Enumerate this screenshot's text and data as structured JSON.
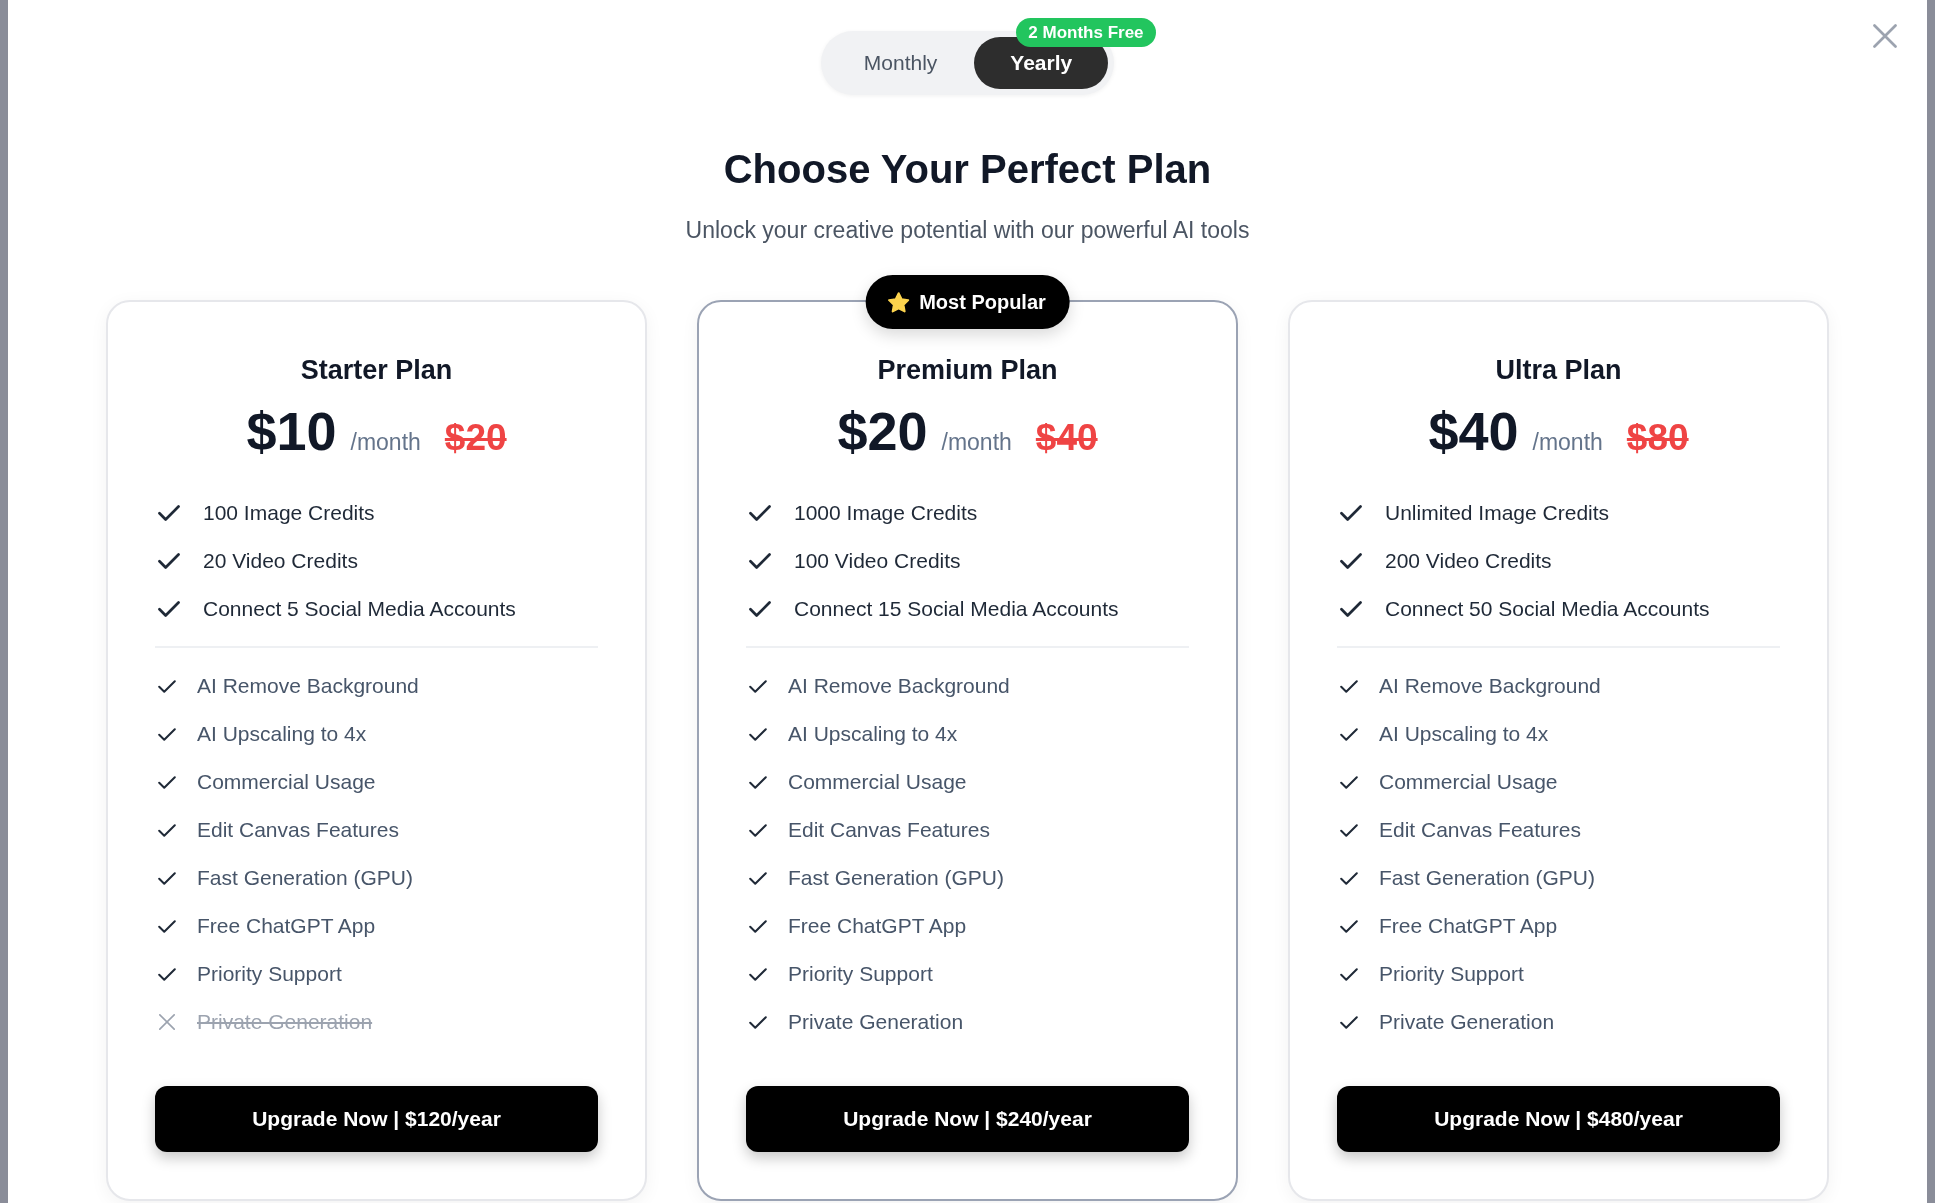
{
  "billing_toggle": {
    "options": [
      {
        "label": "Monthly",
        "selected": false
      },
      {
        "label": "Yearly",
        "selected": true,
        "badge": "2 Months Free"
      }
    ]
  },
  "title": "Choose Your Perfect Plan",
  "subtitle": "Unlock your creative potential with our powerful AI tools",
  "plans": [
    {
      "name": "Starter Plan",
      "featured": false,
      "price": "$10",
      "period": "/month",
      "original_price": "$20",
      "highlights": [
        "100 Image Credits",
        "20 Video Credits",
        "Connect 5 Social Media Accounts"
      ],
      "features": [
        {
          "label": "AI Remove Background",
          "included": true
        },
        {
          "label": "AI Upscaling to 4x",
          "included": true
        },
        {
          "label": "Commercial Usage",
          "included": true
        },
        {
          "label": "Edit Canvas Features",
          "included": true
        },
        {
          "label": "Fast Generation (GPU)",
          "included": true
        },
        {
          "label": "Free ChatGPT App",
          "included": true
        },
        {
          "label": "Priority Support",
          "included": true
        },
        {
          "label": "Private Generation",
          "included": false
        }
      ],
      "button": "Upgrade Now | $120/year"
    },
    {
      "name": "Premium Plan",
      "featured": true,
      "badge": "Most Popular",
      "price": "$20",
      "period": "/month",
      "original_price": "$40",
      "highlights": [
        "1000 Image Credits",
        "100 Video Credits",
        "Connect 15 Social Media Accounts"
      ],
      "features": [
        {
          "label": "AI Remove Background",
          "included": true
        },
        {
          "label": "AI Upscaling to 4x",
          "included": true
        },
        {
          "label": "Commercial Usage",
          "included": true
        },
        {
          "label": "Edit Canvas Features",
          "included": true
        },
        {
          "label": "Fast Generation (GPU)",
          "included": true
        },
        {
          "label": "Free ChatGPT App",
          "included": true
        },
        {
          "label": "Priority Support",
          "included": true
        },
        {
          "label": "Private Generation",
          "included": true
        }
      ],
      "button": "Upgrade Now | $240/year"
    },
    {
      "name": "Ultra Plan",
      "featured": false,
      "price": "$40",
      "period": "/month",
      "original_price": "$80",
      "highlights": [
        "Unlimited Image Credits",
        "200 Video Credits",
        "Connect 50 Social Media Accounts"
      ],
      "features": [
        {
          "label": "AI Remove Background",
          "included": true
        },
        {
          "label": "AI Upscaling to 4x",
          "included": true
        },
        {
          "label": "Commercial Usage",
          "included": true
        },
        {
          "label": "Edit Canvas Features",
          "included": true
        },
        {
          "label": "Fast Generation (GPU)",
          "included": true
        },
        {
          "label": "Free ChatGPT App",
          "included": true
        },
        {
          "label": "Priority Support",
          "included": true
        },
        {
          "label": "Private Generation",
          "included": true
        }
      ],
      "button": "Upgrade Now | $480/year"
    }
  ]
}
